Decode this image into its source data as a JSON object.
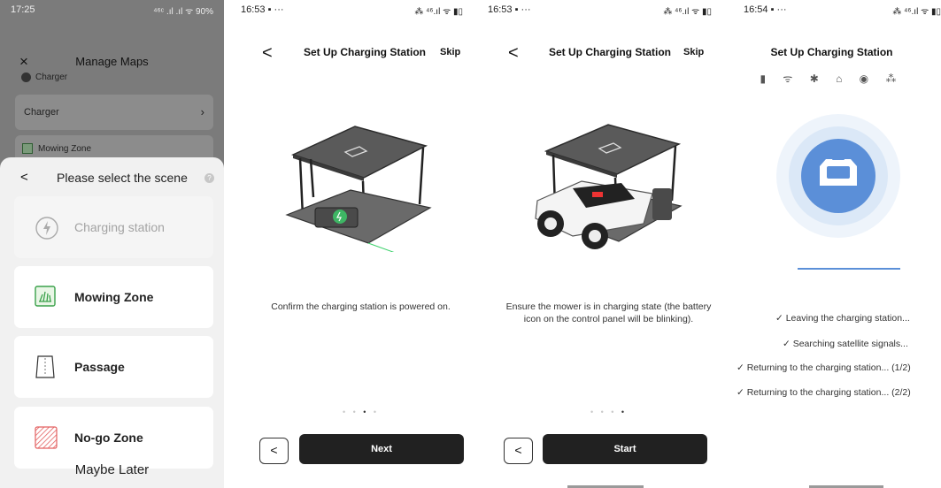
{
  "panel1": {
    "status_time": "17:25",
    "status_right": "⁴⁶ᶜ .ıl .ıl ᯤ 90%",
    "header": {
      "close": "×",
      "title": "Manage Maps"
    },
    "charger_section": "Charger",
    "charger_row": {
      "label": "Charger",
      "chevron": "›"
    },
    "mowing_section": "Mowing Zone",
    "sheet": {
      "back": "<",
      "title": "Please select the scene",
      "help": "?",
      "options": [
        {
          "label": "Charging station",
          "icon": "lightning-circle-icon",
          "disabled": true
        },
        {
          "label": "Mowing Zone",
          "icon": "grass-icon",
          "disabled": false
        },
        {
          "label": "Passage",
          "icon": "passage-icon",
          "disabled": false
        },
        {
          "label": "No-go Zone",
          "icon": "hatched-zone-icon",
          "disabled": false
        }
      ],
      "maybe_later": "Maybe Later"
    }
  },
  "panel2": {
    "status_time": "16:53 ▪ ···",
    "status_right": "⁂ ⁴⁶.ıl ᯤ ▮▯",
    "back": "<",
    "title": "Set Up Charging Station",
    "skip": "Skip",
    "caption": "Confirm the charging station is powered on.",
    "dots_before": "• • ",
    "dots_active": "•",
    "dots_after": " •",
    "prev": "<",
    "primary": "Next"
  },
  "panel3": {
    "status_time": "16:53 ▪ ···",
    "status_right": "⁂ ⁴⁶.ıl ᯤ ▮▯",
    "back": "<",
    "title": "Set Up Charging Station",
    "skip": "Skip",
    "caption": "Ensure the mower is in charging state (the battery icon on the control panel will be blinking).",
    "dots_before": "• • • ",
    "dots_active": "•",
    "dots_after": "",
    "prev": "<",
    "primary": "Start"
  },
  "panel4": {
    "status_time": "16:54 ▪ ···",
    "status_right": "⁂ ⁴⁶.ıl ᯤ ▮▯",
    "title": "Set Up Charging Station",
    "status_icons": "▮ ᯤ ✱ ⌂ ◉ ⁂",
    "checks": [
      "✓  Leaving the charging station...",
      "✓  Searching satellite signals...",
      "✓  Returning to the charging station... (1/2)",
      "✓  Returning to the charging station... (2/2)"
    ],
    "colors": {
      "accent": "#5b8fd8",
      "circle": "#dbe8f7"
    }
  }
}
